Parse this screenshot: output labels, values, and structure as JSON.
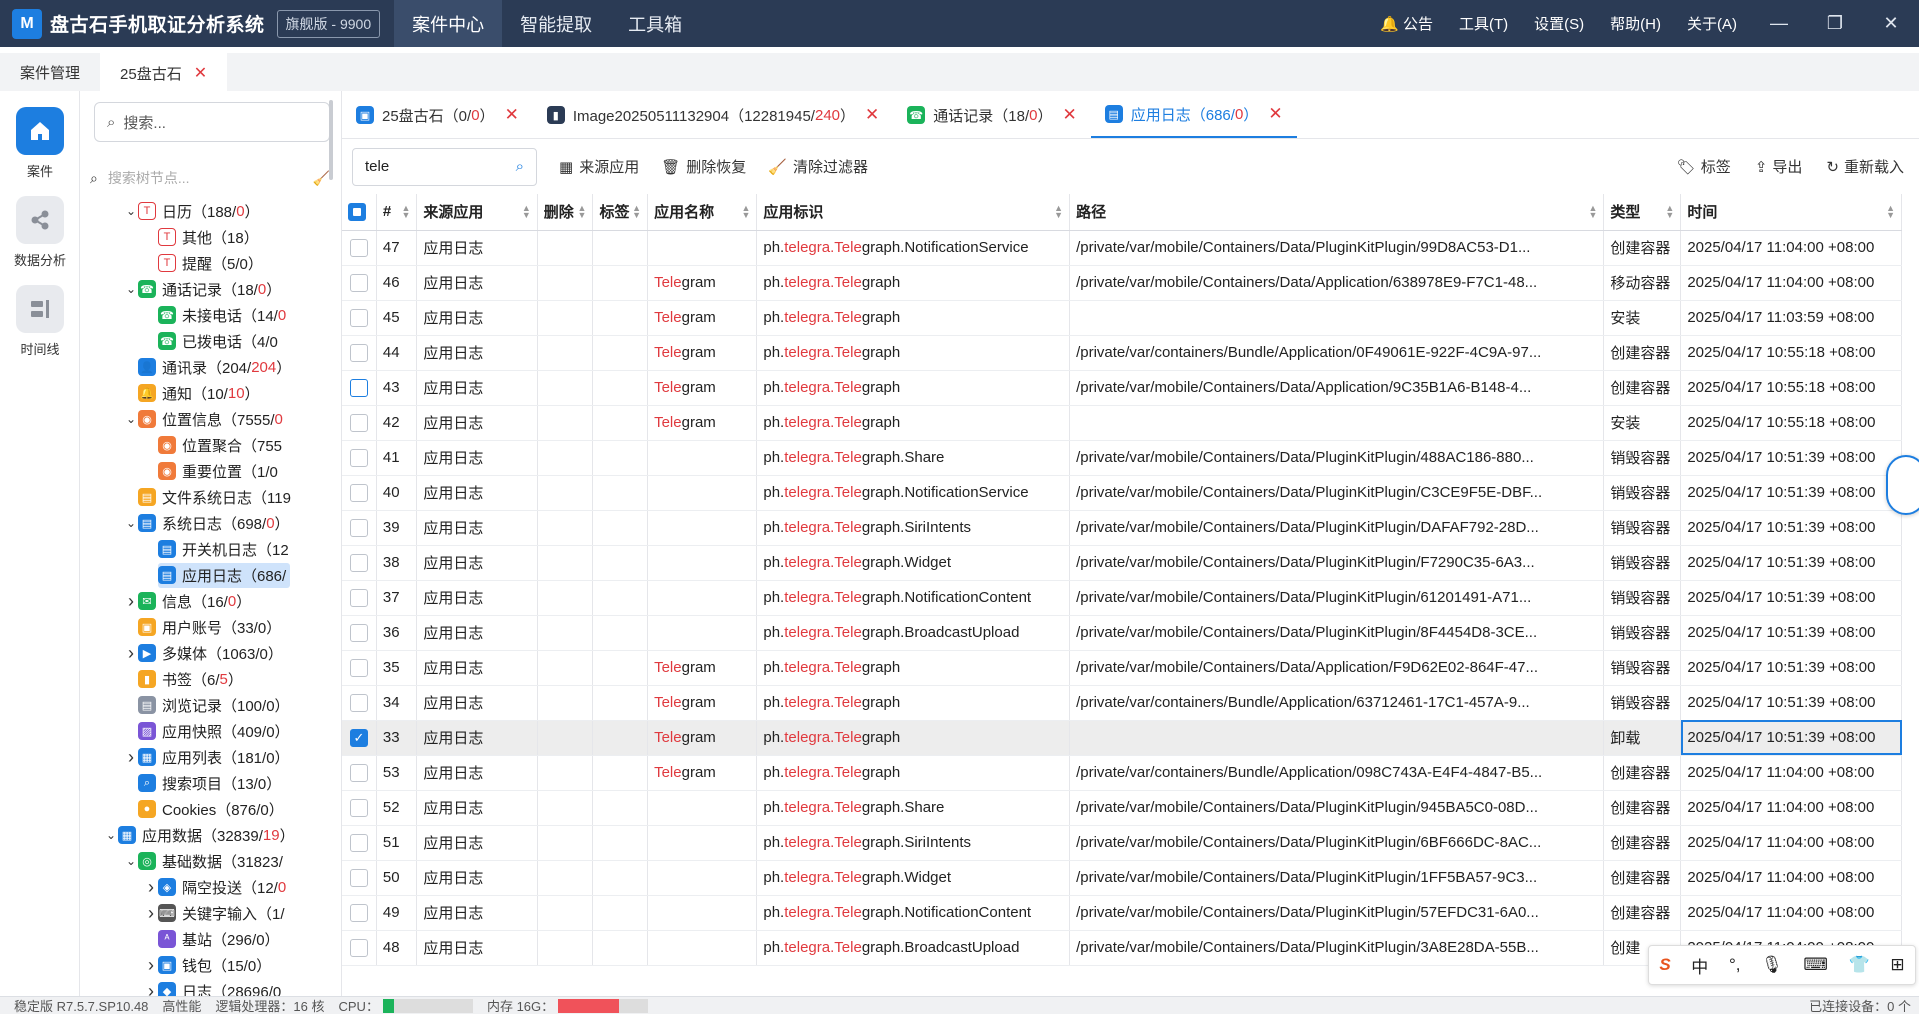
{
  "app": {
    "logo": "M",
    "title": "盘古石手机取证分析系统",
    "edition": "旗舰版 - 9900",
    "nav": [
      "案件中心",
      "智能提取",
      "工具箱"
    ],
    "menu": [
      "公告",
      "工具(T)",
      "设置(S)",
      "帮助(H)",
      "关于(A)"
    ]
  },
  "case_tabs": [
    "案件管理",
    "25盘古石"
  ],
  "rail": [
    "案件",
    "数据分析",
    "时间线"
  ],
  "tree": {
    "search_placeholder": "搜索...",
    "node_search_placeholder": "搜索树节点...",
    "nodes": [
      {
        "indent": 2,
        "arrow": "v",
        "icon": "T",
        "color": "#e0393e",
        "outline": true,
        "label": "日历（188/",
        "count": "0",
        "tail": "）"
      },
      {
        "indent": 3,
        "arrow": "",
        "icon": "T",
        "color": "#e0393e",
        "outline": true,
        "label": "其他（18",
        "count": "",
        "tail": "）"
      },
      {
        "indent": 3,
        "arrow": "",
        "icon": "T",
        "color": "#e0393e",
        "outline": true,
        "label": "提醒（5/0）",
        "count": "",
        "tail": ""
      },
      {
        "indent": 2,
        "arrow": "v",
        "icon": "☎",
        "color": "#1bb35a",
        "outline": false,
        "label": "通话记录（18/",
        "count": "0",
        "tail": "）"
      },
      {
        "indent": 3,
        "arrow": "",
        "icon": "☎",
        "color": "#1bb35a",
        "outline": false,
        "label": "未接电话（14/",
        "count": "0",
        "tail": ""
      },
      {
        "indent": 3,
        "arrow": "",
        "icon": "☎",
        "color": "#1bb35a",
        "outline": false,
        "label": "已拨电话（4/0",
        "count": "",
        "tail": ""
      },
      {
        "indent": 2,
        "arrow": "",
        "icon": "👤",
        "color": "#1d7ee0",
        "outline": false,
        "label": "通讯录（204/",
        "count": "204",
        "tail": "）"
      },
      {
        "indent": 2,
        "arrow": "",
        "icon": "🔔",
        "color": "#f5a623",
        "outline": false,
        "label": "通知（10/",
        "count": "10",
        "tail": "）"
      },
      {
        "indent": 2,
        "arrow": "v",
        "icon": "◉",
        "color": "#f07a3a",
        "outline": false,
        "label": "位置信息（7555/",
        "count": "0",
        "tail": ""
      },
      {
        "indent": 3,
        "arrow": "",
        "icon": "◉",
        "color": "#f07a3a",
        "outline": false,
        "label": "位置聚合（755",
        "count": "",
        "tail": ""
      },
      {
        "indent": 3,
        "arrow": "",
        "icon": "◉",
        "color": "#f07a3a",
        "outline": false,
        "label": "重要位置（1/0",
        "count": "",
        "tail": ""
      },
      {
        "indent": 2,
        "arrow": "",
        "icon": "▤",
        "color": "#f5a623",
        "outline": false,
        "label": "文件系统日志（119",
        "count": "",
        "tail": ""
      },
      {
        "indent": 2,
        "arrow": "v",
        "icon": "▤",
        "color": "#1d7ee0",
        "outline": false,
        "label": "系统日志（698/",
        "count": "0",
        "tail": "）"
      },
      {
        "indent": 3,
        "arrow": "",
        "icon": "▤",
        "color": "#1d7ee0",
        "outline": false,
        "label": "开关机日志（12",
        "count": "",
        "tail": ""
      },
      {
        "indent": 3,
        "arrow": "",
        "icon": "▤",
        "color": "#1d7ee0",
        "outline": false,
        "label": "应用日志（686/",
        "count": "",
        "tail": "",
        "selected": true
      },
      {
        "indent": 2,
        "arrow": ">",
        "icon": "✉",
        "color": "#1bb35a",
        "outline": false,
        "label": "信息（16/",
        "count": "0",
        "tail": "）"
      },
      {
        "indent": 2,
        "arrow": "",
        "icon": "▣",
        "color": "#f5a623",
        "outline": false,
        "label": "用户账号（33/0）",
        "count": "",
        "tail": ""
      },
      {
        "indent": 2,
        "arrow": ">",
        "icon": "▶",
        "color": "#1d7ee0",
        "outline": false,
        "label": "多媒体（1063/0）",
        "count": "",
        "tail": ""
      },
      {
        "indent": 2,
        "arrow": "",
        "icon": "▮",
        "color": "#f5a623",
        "outline": false,
        "label": "书签（6/",
        "count": "5",
        "tail": "）"
      },
      {
        "indent": 2,
        "arrow": "",
        "icon": "▤",
        "color": "#8a93a3",
        "outline": false,
        "label": "浏览记录（100/0）",
        "count": "",
        "tail": ""
      },
      {
        "indent": 2,
        "arrow": "",
        "icon": "▨",
        "color": "#7a55d6",
        "outline": false,
        "label": "应用快照（409/0）",
        "count": "",
        "tail": ""
      },
      {
        "indent": 2,
        "arrow": ">",
        "icon": "▦",
        "color": "#1d7ee0",
        "outline": false,
        "label": "应用列表（181/0）",
        "count": "",
        "tail": ""
      },
      {
        "indent": 2,
        "arrow": "",
        "icon": "⌕",
        "color": "#1d7ee0",
        "outline": false,
        "label": "搜索项目（13/0）",
        "count": "",
        "tail": ""
      },
      {
        "indent": 2,
        "arrow": "",
        "icon": "●",
        "color": "#f5a623",
        "outline": false,
        "label": "Cookies（876/0）",
        "count": "",
        "tail": ""
      },
      {
        "indent": 1,
        "arrow": "v",
        "icon": "▦",
        "color": "#1d7ee0",
        "outline": false,
        "label": "应用数据（32839/",
        "count": "19",
        "tail": "）"
      },
      {
        "indent": 2,
        "arrow": "v",
        "icon": "◎",
        "color": "#1bb35a",
        "outline": false,
        "label": "基础数据（31823/",
        "count": "",
        "tail": ""
      },
      {
        "indent": 3,
        "arrow": ">",
        "icon": "◈",
        "color": "#1d7ee0",
        "outline": false,
        "label": "隔空投送（12/",
        "count": "0",
        "tail": ""
      },
      {
        "indent": 3,
        "arrow": ">",
        "icon": "⌨",
        "color": "#555",
        "outline": false,
        "label": "关键字输入（1/",
        "count": "",
        "tail": ""
      },
      {
        "indent": 3,
        "arrow": "",
        "icon": "ᴬ",
        "color": "#7a55d6",
        "outline": false,
        "label": "基站（296/0）",
        "count": "",
        "tail": ""
      },
      {
        "indent": 3,
        "arrow": ">",
        "icon": "▣",
        "color": "#1d7ee0",
        "outline": false,
        "label": "钱包（15/0）",
        "count": "",
        "tail": ""
      },
      {
        "indent": 3,
        "arrow": ">",
        "icon": "◆",
        "color": "#1d7ee0",
        "outline": false,
        "label": "日志（28696/0",
        "count": "",
        "tail": ""
      }
    ]
  },
  "sub_tabs": [
    {
      "label": "25盘古石（0/",
      "count": "0",
      "tail": "）",
      "color": "#1d7ee0",
      "icon": "▣"
    },
    {
      "label": "Image20250511132904（12281945/",
      "count": "240",
      "tail": "）",
      "color": "#2b3b55",
      "icon": "▮"
    },
    {
      "label": "通话记录（18/",
      "count": "0",
      "tail": "）",
      "color": "#1bb35a",
      "icon": "☎"
    },
    {
      "label": "应用日志（686/",
      "count": "0",
      "tail": "）",
      "color": "#1d7ee0",
      "icon": "▤",
      "active": true
    }
  ],
  "toolbar": {
    "search_value": "tele",
    "buttons": [
      "来源应用",
      "删除恢复",
      "清除过滤器"
    ],
    "right_buttons": [
      "标签",
      "导出",
      "重新载入"
    ]
  },
  "table": {
    "columns": [
      "#",
      "来源应用",
      "删除",
      "标签",
      "应用名称",
      "应用标识",
      "路径",
      "类型",
      "时间"
    ],
    "rows": [
      {
        "id": "47",
        "src": "应用日志",
        "name": "",
        "bundle_pre": "ph.",
        "bundle_mid": "telegra.",
        "bundle_hl": "Tele",
        "bundle_post": "graph.NotificationService",
        "path": "/private/var/mobile/Containers/Data/PluginKitPlugin/99D8AC53-D1...",
        "type": "创建容器",
        "time": "2025/04/17 11:04:00 +08:00"
      },
      {
        "id": "46",
        "src": "应用日志",
        "name": "Telegram",
        "bundle_pre": "ph.",
        "bundle_mid": "telegra.",
        "bundle_hl": "Tele",
        "bundle_post": "graph",
        "path": "/private/var/mobile/Containers/Data/Application/638978E9-F7C1-48...",
        "type": "移动容器",
        "time": "2025/04/17 11:04:00 +08:00"
      },
      {
        "id": "45",
        "src": "应用日志",
        "name": "Telegram",
        "bundle_pre": "ph.",
        "bundle_mid": "telegra.",
        "bundle_hl": "Tele",
        "bundle_post": "graph",
        "path": "",
        "type": "安装",
        "time": "2025/04/17 11:03:59 +08:00"
      },
      {
        "id": "44",
        "src": "应用日志",
        "name": "Telegram",
        "bundle_pre": "ph.",
        "bundle_mid": "telegra.",
        "bundle_hl": "Tele",
        "bundle_post": "graph",
        "path": "/private/var/containers/Bundle/Application/0F49061E-922F-4C9A-97...",
        "type": "创建容器",
        "time": "2025/04/17 10:55:18 +08:00"
      },
      {
        "id": "43",
        "src": "应用日志",
        "name": "Telegram",
        "bundle_pre": "ph.",
        "bundle_mid": "telegra.",
        "bundle_hl": "Tele",
        "bundle_post": "graph",
        "path": "/private/var/mobile/Containers/Data/Application/9C35B1A6-B148-4...",
        "type": "创建容器",
        "time": "2025/04/17 10:55:18 +08:00",
        "hover": true
      },
      {
        "id": "42",
        "src": "应用日志",
        "name": "Telegram",
        "bundle_pre": "ph.",
        "bundle_mid": "telegra.",
        "bundle_hl": "Tele",
        "bundle_post": "graph",
        "path": "",
        "type": "安装",
        "time": "2025/04/17 10:55:18 +08:00"
      },
      {
        "id": "41",
        "src": "应用日志",
        "name": "",
        "bundle_pre": "ph.",
        "bundle_mid": "telegra.",
        "bundle_hl": "Tele",
        "bundle_post": "graph.Share",
        "path": "/private/var/mobile/Containers/Data/PluginKitPlugin/488AC186-880...",
        "type": "销毁容器",
        "time": "2025/04/17 10:51:39 +08:00"
      },
      {
        "id": "40",
        "src": "应用日志",
        "name": "",
        "bundle_pre": "ph.",
        "bundle_mid": "telegra.",
        "bundle_hl": "Tele",
        "bundle_post": "graph.NotificationService",
        "path": "/private/var/mobile/Containers/Data/PluginKitPlugin/C3CE9F5E-DBF...",
        "type": "销毁容器",
        "time": "2025/04/17 10:51:39 +08:00"
      },
      {
        "id": "39",
        "src": "应用日志",
        "name": "",
        "bundle_pre": "ph.",
        "bundle_mid": "telegra.",
        "bundle_hl": "Tele",
        "bundle_post": "graph.SiriIntents",
        "path": "/private/var/mobile/Containers/Data/PluginKitPlugin/DAFAF792-28D...",
        "type": "销毁容器",
        "time": "2025/04/17 10:51:39 +08:00"
      },
      {
        "id": "38",
        "src": "应用日志",
        "name": "",
        "bundle_pre": "ph.",
        "bundle_mid": "telegra.",
        "bundle_hl": "Tele",
        "bundle_post": "graph.Widget",
        "path": "/private/var/mobile/Containers/Data/PluginKitPlugin/F7290C35-6A3...",
        "type": "销毁容器",
        "time": "2025/04/17 10:51:39 +08:00"
      },
      {
        "id": "37",
        "src": "应用日志",
        "name": "",
        "bundle_pre": "ph.",
        "bundle_mid": "telegra.",
        "bundle_hl": "Tele",
        "bundle_post": "graph.NotificationContent",
        "path": "/private/var/mobile/Containers/Data/PluginKitPlugin/61201491-A71...",
        "type": "销毁容器",
        "time": "2025/04/17 10:51:39 +08:00"
      },
      {
        "id": "36",
        "src": "应用日志",
        "name": "",
        "bundle_pre": "ph.",
        "bundle_mid": "telegra.",
        "bundle_hl": "Tele",
        "bundle_post": "graph.BroadcastUpload",
        "path": "/private/var/mobile/Containers/Data/PluginKitPlugin/8F4454D8-3CE...",
        "type": "销毁容器",
        "time": "2025/04/17 10:51:39 +08:00"
      },
      {
        "id": "35",
        "src": "应用日志",
        "name": "Telegram",
        "bundle_pre": "ph.",
        "bundle_mid": "telegra.",
        "bundle_hl": "Tele",
        "bundle_post": "graph",
        "path": "/private/var/mobile/Containers/Data/Application/F9D62E02-864F-47...",
        "type": "销毁容器",
        "time": "2025/04/17 10:51:39 +08:00"
      },
      {
        "id": "34",
        "src": "应用日志",
        "name": "Telegram",
        "bundle_pre": "ph.",
        "bundle_mid": "telegra.",
        "bundle_hl": "Tele",
        "bundle_post": "graph",
        "path": "/private/var/containers/Bundle/Application/63712461-17C1-457A-9...",
        "type": "销毁容器",
        "time": "2025/04/17 10:51:39 +08:00"
      },
      {
        "id": "33",
        "src": "应用日志",
        "name": "Telegram",
        "bundle_pre": "ph.",
        "bundle_mid": "telegra.",
        "bundle_hl": "Tele",
        "bundle_post": "graph",
        "path": "",
        "type": "卸载",
        "time": "2025/04/17 10:51:39 +08:00",
        "selected": true
      },
      {
        "id": "53",
        "src": "应用日志",
        "name": "Telegram",
        "bundle_pre": "ph.",
        "bundle_mid": "telegra.",
        "bundle_hl": "Tele",
        "bundle_post": "graph",
        "path": "/private/var/containers/Bundle/Application/098C743A-E4F4-4847-B5...",
        "type": "创建容器",
        "time": "2025/04/17 11:04:00 +08:00"
      },
      {
        "id": "52",
        "src": "应用日志",
        "name": "",
        "bundle_pre": "ph.",
        "bundle_mid": "telegra.",
        "bundle_hl": "Tele",
        "bundle_post": "graph.Share",
        "path": "/private/var/mobile/Containers/Data/PluginKitPlugin/945BA5C0-08D...",
        "type": "创建容器",
        "time": "2025/04/17 11:04:00 +08:00"
      },
      {
        "id": "51",
        "src": "应用日志",
        "name": "",
        "bundle_pre": "ph.",
        "bundle_mid": "telegra.",
        "bundle_hl": "Tele",
        "bundle_post": "graph.SiriIntents",
        "path": "/private/var/mobile/Containers/Data/PluginKitPlugin/6BF666DC-8AC...",
        "type": "创建容器",
        "time": "2025/04/17 11:04:00 +08:00"
      },
      {
        "id": "50",
        "src": "应用日志",
        "name": "",
        "bundle_pre": "ph.",
        "bundle_mid": "telegra.",
        "bundle_hl": "Tele",
        "bundle_post": "graph.Widget",
        "path": "/private/var/mobile/Containers/Data/PluginKitPlugin/1FF5BA57-9C3...",
        "type": "创建容器",
        "time": "2025/04/17 11:04:00 +08:00"
      },
      {
        "id": "49",
        "src": "应用日志",
        "name": "",
        "bundle_pre": "ph.",
        "bundle_mid": "telegra.",
        "bundle_hl": "Tele",
        "bundle_post": "graph.NotificationContent",
        "path": "/private/var/mobile/Containers/Data/PluginKitPlugin/57EFDC31-6A0...",
        "type": "创建容器",
        "time": "2025/04/17 11:04:00 +08:00"
      },
      {
        "id": "48",
        "src": "应用日志",
        "name": "",
        "bundle_pre": "ph.",
        "bundle_mid": "telegra.",
        "bundle_hl": "Tele",
        "bundle_post": "graph.BroadcastUpload",
        "path": "/private/var/mobile/Containers/Data/PluginKitPlugin/3A8E28DA-55B...",
        "type": "创建",
        "time": "2025/04/17 11:04:00 +08:00"
      }
    ]
  },
  "status": {
    "version": "稳定版  R7.5.7.SP10.48",
    "perf": "高性能",
    "cpu_cores": "逻辑处理器：16 核",
    "cpu_label": "CPU：",
    "cpu_level": 0.12,
    "mem_label": "内存 16G：",
    "mem_level": 0.68,
    "devices": "已连接设备：0 个"
  },
  "ime": [
    "中",
    "°,",
    "🎙",
    "⌨",
    "👕",
    "⊞"
  ],
  "colors": {
    "accent": "#1d7ee0",
    "highlight": "#e0393e",
    "titlebar": "#2b3b55"
  }
}
